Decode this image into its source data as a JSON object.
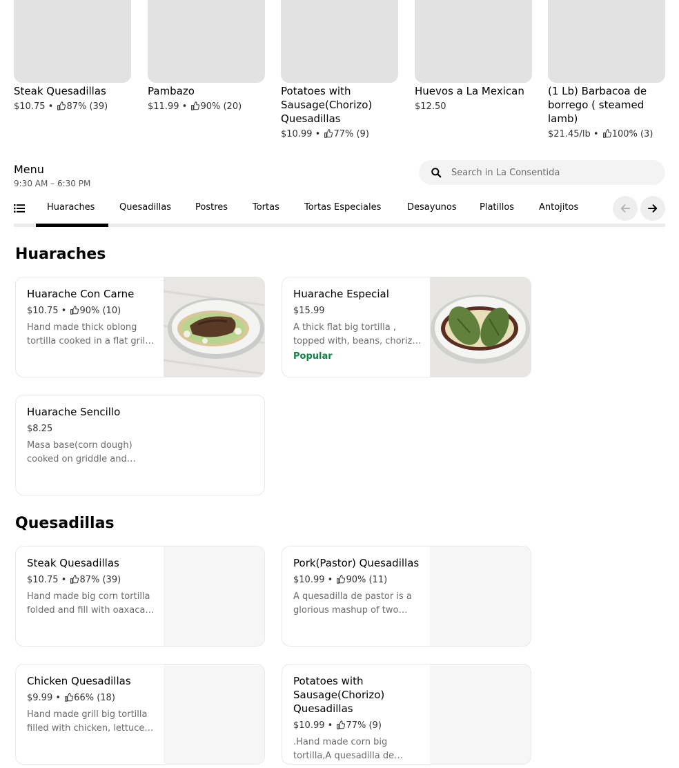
{
  "featured": [
    {
      "name": "Steak Quesadillas",
      "price": "$10.75",
      "rating": "87% (39)"
    },
    {
      "name": "Pambazo",
      "price": "$11.99",
      "rating": "90% (20)"
    },
    {
      "name": "Potatoes with Sausage(Chorizo) Quesadillas",
      "price": "$10.99",
      "rating": "77% (9)"
    },
    {
      "name": "Huevos a  La Mexican",
      "price": "$12.50",
      "rating": ""
    },
    {
      "name": "(1 Lb) Barbacoa de borrego ( steamed lamb)",
      "price": "$21.45/lb",
      "rating": "100% (3)"
    }
  ],
  "menu": {
    "title": "Menu",
    "hours": "9:30 AM – 6:30 PM"
  },
  "search": {
    "placeholder": "Search in La Consentida",
    "value": "",
    "icon": "search-icon"
  },
  "tabs": [
    "Huaraches",
    "Quesadillas",
    "Postres",
    "Tortas",
    "Tortas Especiales",
    "Desayunos",
    "Platillos",
    "Antojitos"
  ],
  "active_tab": "Huaraches",
  "separator": "•",
  "sections": [
    {
      "title": "Huaraches",
      "items": [
        {
          "name": "Huarache Con Carne",
          "price": "$10.75",
          "rating": "90% (10)",
          "description": "Hand made thick oblong tortilla cooked in a flat grill topped with beans, steak, lettuce and cheese",
          "badge": "",
          "photo": "huarache-steak"
        },
        {
          "name": "Huarache Especial",
          "price": "$15.99",
          "rating": "",
          "description": "A thick flat big tortilla , topped with, beans, chorizo, cactus and cheese",
          "badge": "Popular",
          "photo": "huarache-cactus"
        },
        {
          "name": "Huarache Sencillo",
          "price": "$8.25",
          "rating": "",
          "description": "Masa base(corn dough) cooked on griddle and topped with beans and cheese",
          "badge": "",
          "photo": ""
        }
      ]
    },
    {
      "title": "Quesadillas",
      "items": [
        {
          "name": "Steak Quesadillas",
          "price": "$10.75",
          "rating": "87% (39)",
          "description": "Hand made big corn tortilla folded and fill with oaxaca cheese and steak",
          "badge": "",
          "photo": "blank"
        },
        {
          "name": "Pork(Pastor) Quesadillas",
          "price": "$10.99",
          "rating": "90% (11)",
          "description": "A quesadilla de pastor is a glorious mashup of two Mexican favorites",
          "badge": "",
          "photo": "blank"
        },
        {
          "name": "Chicken Quesadillas",
          "price": "$9.99",
          "rating": "66% (18)",
          "description": "Hand made grill big tortilla filled with chicken, lettuce, cheese and cream",
          "badge": "",
          "photo": "blank"
        },
        {
          "name": "Potatoes with Sausage(Chorizo) Quesadillas",
          "price": "$10.99",
          "rating": "77% (9)",
          "description": ".Hand made corn big tortilla,A quesadilla de papas con chorizo",
          "badge": "",
          "photo": "blank"
        }
      ]
    }
  ],
  "colors": {
    "accent": "#000000",
    "popular": "#0e8345",
    "placeholder_bg": "#e2e2e2"
  }
}
